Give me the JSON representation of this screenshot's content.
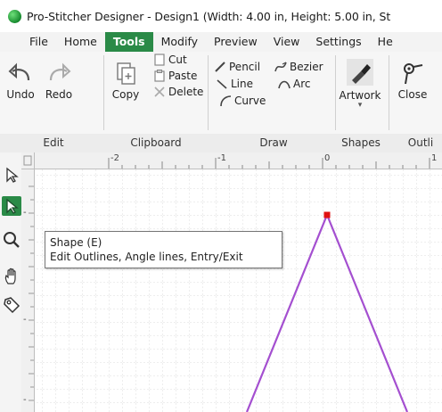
{
  "window": {
    "title": "Pro-Stitcher Designer - Design1 (Width: 4.00 in, Height: 5.00 in, St"
  },
  "menu": {
    "items": [
      "File",
      "Home",
      "Tools",
      "Modify",
      "Preview",
      "View",
      "Settings",
      "He"
    ],
    "active": "Tools"
  },
  "ribbon": {
    "edit": {
      "undo": "Undo",
      "redo": "Redo",
      "group_label": "Edit"
    },
    "clipboard": {
      "copy": "Copy",
      "cut": "Cut",
      "paste": "Paste",
      "delete": "Delete",
      "group_label": "Clipboard"
    },
    "draw": {
      "pencil": "Pencil",
      "bezier": "Bezier",
      "line": "Line",
      "arc": "Arc",
      "curve": "Curve",
      "group_label": "Draw"
    },
    "shapes": {
      "artwork": "Artwork",
      "group_label": "Shapes"
    },
    "outline": {
      "close": "Close",
      "group_label": "Outli"
    }
  },
  "ruler": {
    "top_labels": [
      "-2",
      "-1",
      "0",
      "1"
    ],
    "left_labels": [
      "-",
      "-",
      "-"
    ]
  },
  "tooltip": {
    "title": "Shape (E)",
    "description": "Edit Outlines, Angle lines, Entry/Exit"
  },
  "colors": {
    "accent": "#2a8a47",
    "outline_stroke": "#a44fd0",
    "point_marker": "#e01010"
  },
  "tools": [
    "select-arrow-icon",
    "shape-edit-icon",
    "zoom-icon",
    "pan-hand-icon",
    "tag-icon"
  ]
}
